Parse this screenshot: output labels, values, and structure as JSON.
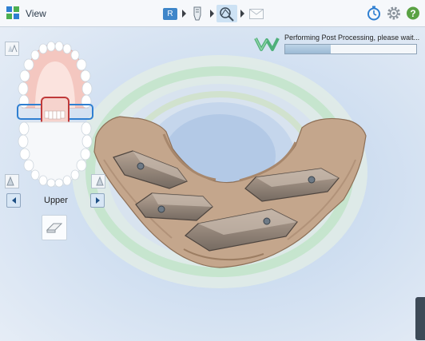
{
  "header": {
    "title": "View",
    "workflow_step_badge": "R",
    "workflow_icons": [
      "rx-icon",
      "scan-tooth-icon",
      "view-analysis-icon",
      "send-envelope-icon"
    ],
    "right_icons": [
      "timer-icon",
      "settings-gear-icon",
      "help-icon"
    ]
  },
  "jaw_panel": {
    "selected_jaw": "Upper",
    "selection_color": "#c03a3a",
    "gum_color": "#f4c7c0"
  },
  "progress": {
    "message": "Performing Post Processing, please wait...",
    "percent": 35
  },
  "colors": {
    "accent": "#3f86c9",
    "model": "#c2a48a",
    "scan_body": "#8f8176"
  }
}
